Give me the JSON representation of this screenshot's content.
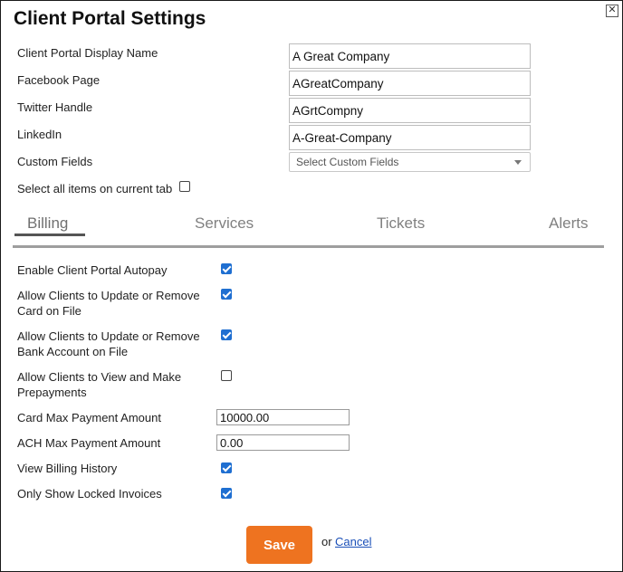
{
  "dialog": {
    "title": "Client Portal Settings",
    "close_glyph": "✕"
  },
  "fields": {
    "display_name": {
      "label": "Client Portal Display Name",
      "value": "A Great Company"
    },
    "facebook": {
      "label": "Facebook Page",
      "value": "AGreatCompany"
    },
    "twitter": {
      "label": "Twitter Handle",
      "value": "AGrtCompny"
    },
    "linkedin": {
      "label": "LinkedIn",
      "value": "A-Great-Company"
    },
    "custom_fields": {
      "label": "Custom Fields",
      "placeholder": "Select Custom Fields"
    }
  },
  "select_all": {
    "label": "Select all items on current tab",
    "checked": false
  },
  "tabs": [
    {
      "label": "Billing",
      "active": true
    },
    {
      "label": "Services",
      "active": false
    },
    {
      "label": "Tickets",
      "active": false
    },
    {
      "label": "Alerts",
      "active": false
    }
  ],
  "billing": {
    "autopay": {
      "label": "Enable Client Portal Autopay",
      "checked": true
    },
    "update_card": {
      "label": "Allow Clients to Update or Remove Card on File",
      "checked": true
    },
    "update_bank": {
      "label": "Allow Clients to Update or Remove Bank Account on File",
      "checked": true
    },
    "prepayments": {
      "label": "Allow Clients to View and Make Prepayments",
      "checked": false
    },
    "card_max": {
      "label": "Card Max Payment Amount",
      "value": "10000.00"
    },
    "ach_max": {
      "label": "ACH Max Payment Amount",
      "value": "0.00"
    },
    "billing_history": {
      "label": "View Billing History",
      "checked": true
    },
    "locked_invoices": {
      "label": "Only Show Locked Invoices",
      "checked": true
    }
  },
  "footer": {
    "save_label": "Save",
    "or_text": "or",
    "cancel_label": "Cancel"
  },
  "colors": {
    "accent": "#ee7320",
    "checkbox": "#1f6fd1",
    "link": "#1a4fb8"
  }
}
